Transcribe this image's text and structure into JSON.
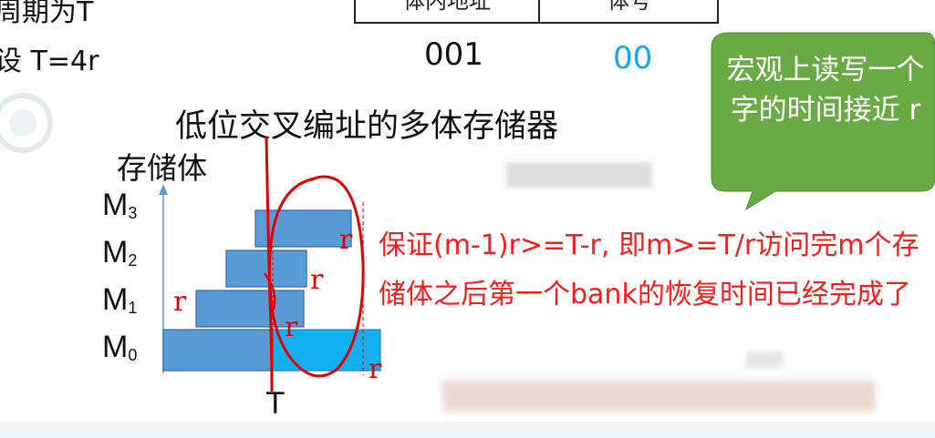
{
  "top_left": {
    "line1": "周期为T",
    "line2": "设 T=4r"
  },
  "address_table": {
    "header_left": "体内地址",
    "header_right": "体号",
    "address_value": "001",
    "bank_value": "00"
  },
  "diagram": {
    "title": "低位交叉编址的多体存储器",
    "y_axis_label": "存储体",
    "banks": [
      "M",
      "M",
      "M",
      "M"
    ],
    "bank_indices": [
      "3",
      "2",
      "1",
      "0"
    ],
    "time_label": "T",
    "r_labels": [
      "r",
      "r",
      "r",
      "r",
      "r"
    ]
  },
  "annotation": {
    "text": "保证(m-1)r>=T-r, 即m>=T/r访问完m个存储体之后第一个bank的恢复时间已经完成了"
  },
  "callout": {
    "text": "宏观上读写一个字的时间接近 r"
  },
  "colors": {
    "bar_fill": "#5b9bd5",
    "highlight_fill": "#12b0f0",
    "bubble_fill": "#6aaa45",
    "annotation_red": "#ff1a1a",
    "bank_blue": "#1aa6e8"
  }
}
